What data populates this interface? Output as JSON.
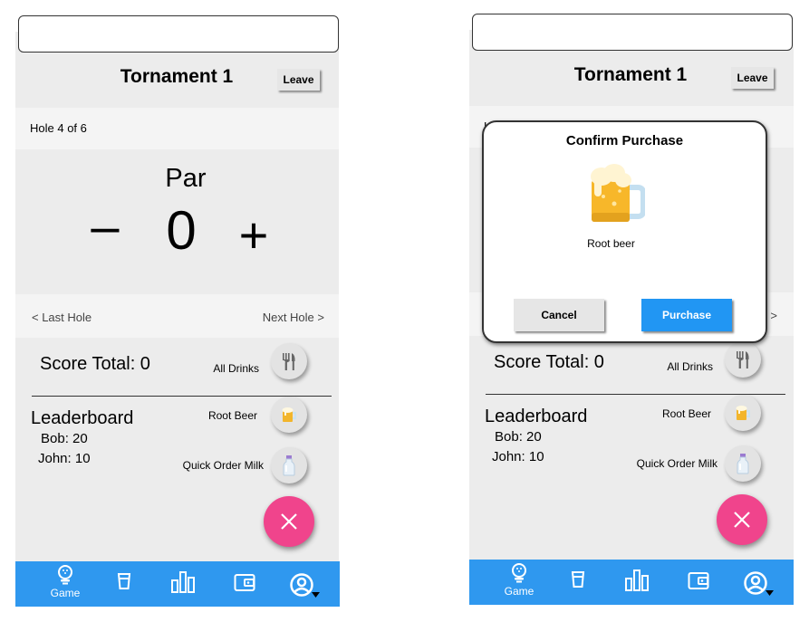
{
  "screen1": {
    "header": {
      "title": "Tornament 1",
      "leave_label": "Leave"
    },
    "hole": {
      "label": "Hole 4 of 6"
    },
    "score": {
      "par_label": "Par",
      "value": "0",
      "minus": "–",
      "plus": "+"
    },
    "nav": {
      "last": "< Last Hole",
      "next": "Next Hole >"
    },
    "score_total": "Score Total: 0",
    "leaderboard": {
      "title": "Leaderboard",
      "entries": [
        "Bob: 20",
        "John: 10"
      ]
    },
    "drinks": [
      {
        "label": "All Drinks",
        "icon": "utensils-icon"
      },
      {
        "label": "Root Beer",
        "icon": "beer-mug-icon"
      },
      {
        "label": "Quick Order Milk",
        "icon": "milk-bottle-icon"
      }
    ],
    "fab_icon": "close-icon",
    "tabbar": {
      "game_label": "Game"
    }
  },
  "screen2": {
    "header": {
      "title": "Tornament 1",
      "leave_label": "Leave"
    },
    "hole": {
      "label": "H"
    },
    "nav": {
      "next": ">"
    },
    "score_total": "Score Total: 0",
    "leaderboard": {
      "title": "Leaderboard",
      "entries": [
        "Bob: 20",
        "John: 10"
      ]
    },
    "drinks": [
      {
        "label": "All Drinks",
        "icon": "utensils-icon"
      },
      {
        "label": "Root Beer",
        "icon": "beer-mug-icon"
      },
      {
        "label": "Quick Order Milk",
        "icon": "milk-bottle-icon"
      }
    ],
    "modal": {
      "title": "Confirm Purchase",
      "item": "Root beer",
      "icon": "beer-mug-icon",
      "cancel_label": "Cancel",
      "purchase_label": "Purchase"
    },
    "tabbar": {
      "game_label": "Game"
    }
  },
  "colors": {
    "fab": "#f0448c",
    "tabbar": "#2f98ef",
    "purchase_button": "#2196f3",
    "phone_background": "#ececec"
  }
}
